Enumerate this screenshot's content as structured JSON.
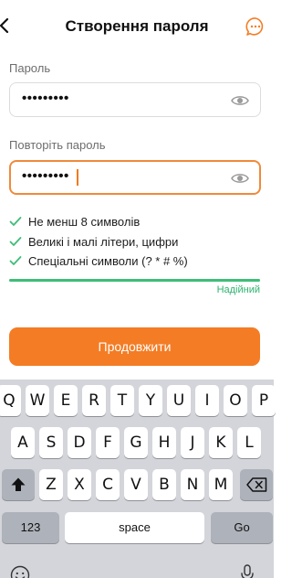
{
  "header": {
    "title": "Створення пароля"
  },
  "password": {
    "label": "Пароль",
    "value": "•••••••••"
  },
  "confirm": {
    "label": "Повторіть пароль",
    "value": "•••••••••"
  },
  "requirements": [
    {
      "text": "Не менш 8 символів"
    },
    {
      "text": "Великі і малі літери, цифри"
    },
    {
      "text": "Спеціальні символи (? * # %)"
    }
  ],
  "strength": {
    "label": "Надійний",
    "level": 1.0
  },
  "continue_label": "Продовжити",
  "keyboard": {
    "row1": [
      "Q",
      "W",
      "E",
      "R",
      "T",
      "Y",
      "U",
      "I",
      "O",
      "P"
    ],
    "row2": [
      "A",
      "S",
      "D",
      "F",
      "G",
      "H",
      "J",
      "K",
      "L"
    ],
    "row3": [
      "Z",
      "X",
      "C",
      "V",
      "B",
      "N",
      "M"
    ],
    "numbers_label": "123",
    "space_label": "space",
    "go_label": "Go"
  },
  "colors": {
    "accent": "#f47c24",
    "success": "#3ebd78"
  }
}
